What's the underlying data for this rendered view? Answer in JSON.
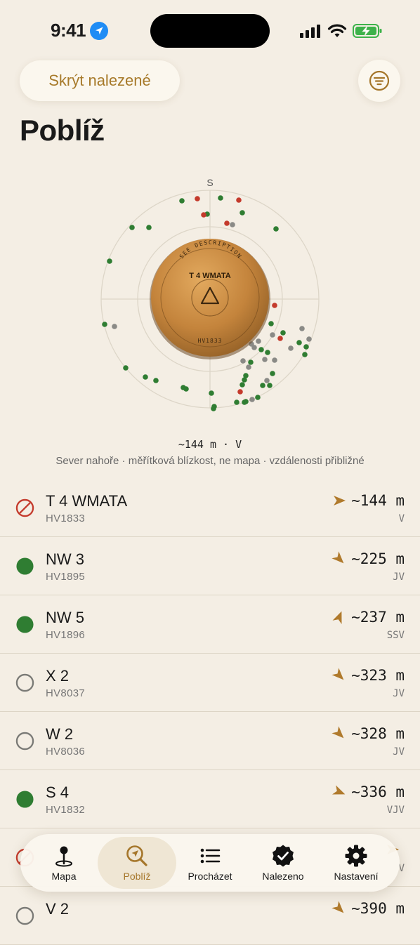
{
  "status_bar": {
    "time": "9:41"
  },
  "header": {
    "hide_found_label": "Skrýt nalezené",
    "title": "Poblíž"
  },
  "radar": {
    "north_label": "S",
    "center_mark": {
      "name": "T 4 WMATA",
      "code": "HV1833",
      "rim_text": "SEE DESCRIPTION"
    },
    "summary": "~144 m · V",
    "caption": "Sever nahoře · měřítková blízkost, ne mapa · vzdálenosti přibližné",
    "colors": {
      "found": "#2f7d32",
      "unknown": "#8a8a86",
      "unreachable": "#c43a2c"
    }
  },
  "list": {
    "items": [
      {
        "name": "T 4 WMATA",
        "code": "HV1833",
        "distance": "~144 m",
        "direction": "V",
        "status": "not-found-mark",
        "bearing_deg": 90
      },
      {
        "name": "NW 3",
        "code": "HV1895",
        "distance": "~225 m",
        "direction": "JV",
        "status": "found",
        "bearing_deg": 135
      },
      {
        "name": "NW 5",
        "code": "HV1896",
        "distance": "~237 m",
        "direction": "SSV",
        "status": "found",
        "bearing_deg": 22
      },
      {
        "name": "X 2",
        "code": "HV8037",
        "distance": "~323 m",
        "direction": "JV",
        "status": "unvisited",
        "bearing_deg": 135
      },
      {
        "name": "W 2",
        "code": "HV8036",
        "distance": "~328 m",
        "direction": "JV",
        "status": "unvisited",
        "bearing_deg": 135
      },
      {
        "name": "S 4",
        "code": "HV1832",
        "distance": "~336 m",
        "direction": "VJV",
        "status": "found",
        "bearing_deg": 112
      },
      {
        "name": "",
        "code": "",
        "distance": "",
        "direction": "V",
        "status": "not-found-mark",
        "bearing_deg": 90
      },
      {
        "name": "V 2",
        "code": "",
        "distance": "~390 m",
        "direction": "",
        "status": "unvisited",
        "bearing_deg": 135
      }
    ]
  },
  "tab_bar": {
    "tabs": [
      {
        "label": "Mapa",
        "icon": "map-pin-icon"
      },
      {
        "label": "Poblíž",
        "icon": "nearby-search-icon"
      },
      {
        "label": "Procházet",
        "icon": "list-icon"
      },
      {
        "label": "Nalezeno",
        "icon": "found-badge-icon"
      },
      {
        "label": "Nastavení",
        "icon": "gear-icon"
      }
    ],
    "active": "Poblíž"
  }
}
